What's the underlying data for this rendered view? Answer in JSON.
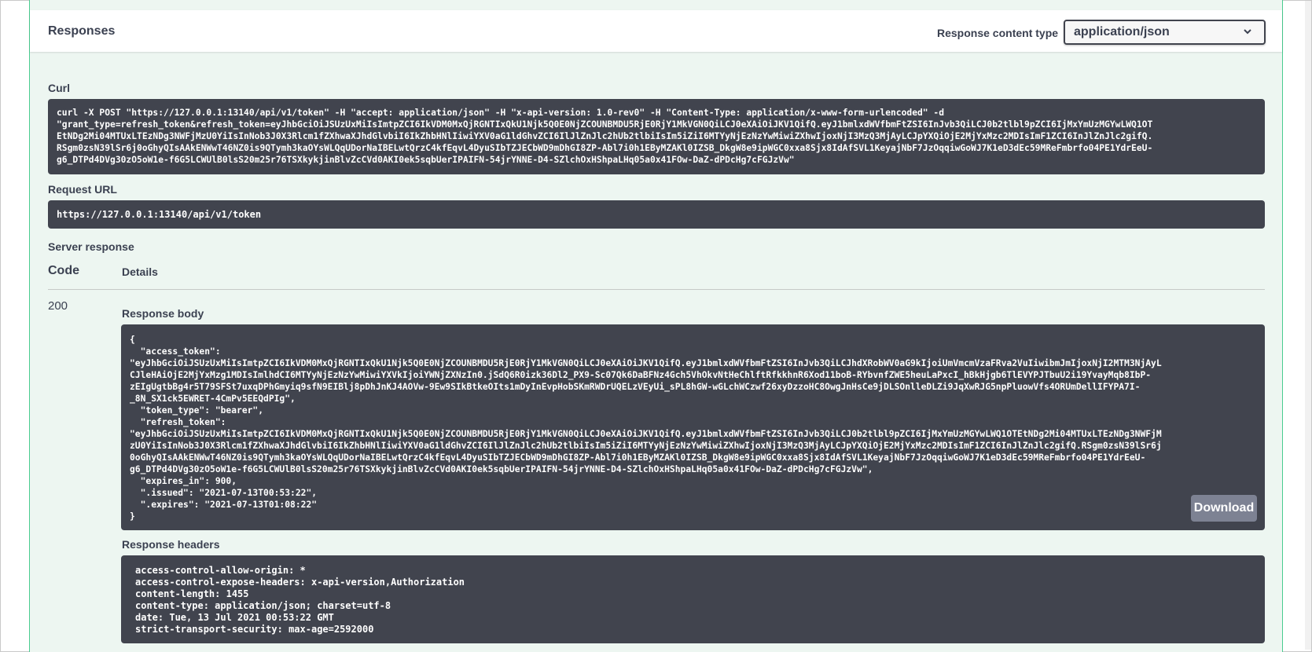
{
  "responses": {
    "title": "Responses",
    "content_type_label": "Response content type",
    "content_type_value": "application/json",
    "content_type_icon": "chevron-down-icon"
  },
  "curl": {
    "label": "Curl",
    "lines": [
      "curl -X POST \"https://127.0.0.1:13140/api/v1/token\" -H \"accept: application/json\" -H \"x-api-version: 1.0-rev0\" -H \"Content-Type: application/x-www-form-urlencoded\" -d",
      "\"grant_type=refresh_token&refresh_token=eyJhbGciOiJSUzUxMiIsImtpZCI6IkVDM0MxQjRGNTIxQkU1Njk5Q0E0NjZCOUNBMDU5RjE0RjY1MkVGN0QiLCJ0eXAiOiJKV1QifQ.eyJ1bmlxdWVfbmFtZSI6InJvb3QiLCJ0b2tlbl9pZCI6IjMxYmUzMGYwLWQ1OT",
      "EtNDg2Mi04MTUxLTEzNDg3NWFjMzU0YiIsInNob3J0X3Rlcm1fZXhwaXJhdGlvbiI6IkZhbHNlIiwiYXV0aG1ldGhvZCI6IlJlZnJlc2hUb2tlbiIsIm5iZiI6MTYyNjEzNzYwMiwiZXhwIjoxNjI3MzQ3MjAyLCJpYXQiOjE2MjYxMzc2MDIsImF1ZCI6InJlZnJlc2gifQ.",
      "RSgm0zsN39lSr6j0oGhyQIsAAkENWwT46NZ0is9QTymh3kaOYsWLQqUDorNaIBELwtQrzC4kfEqvL4DyuSIbTZJECbWD9mDhGI8ZP-Abl7i0h1EByMZAKl0IZSB_DkgW8e9ipWGC0xxa8Sjx8IdAfSVL1KeyajNbF7JzOqqiwGoWJ7K1eD3dEc59MReFmbrfo04PE1YdrEeU-",
      "g6_DTPd4DVg30zO5oW1e-f6G5LCWUlB0lsS20m25r76TSXkykjinBlvZcCVd0AKI0ek5sqbUerIPAIFN-54jrYNNE-D4-SZlchOxHShpaLHq05a0x41FOw-DaZ-dPDcHg7cFGJzVw\""
    ]
  },
  "request_url": {
    "label": "Request URL",
    "value": "https://127.0.0.1:13140/api/v1/token"
  },
  "server_response": {
    "label": "Server response",
    "code_header": "Code",
    "details_header": "Details",
    "code": "200",
    "body_label": "Response body",
    "body_lines": [
      "{",
      "  \"access_token\":",
      "\"eyJhbGciOiJSUzUxMiIsImtpZCI6IkVDM0MxQjRGNTIxQkU1Njk5Q0E0NjZCOUNBMDU5RjE0RjY1MkVGN0QiLCJ0eXAiOiJKV1QifQ.eyJ1bmlxdWVfbmFtZSI6InJvb3QiLCJhdXRobWV0aG9kIjoiUmVmcmVzaFRva2VuIiwibmJmIjoxNjI2MTM3NjAyL",
      "CJleHAiOjE2MjYxMzg1MDIsImlhdCI6MTYyNjEzNzYwMiwiYXVkIjoiYWNjZXNzIn0.jSdQ6R0izk36Dl2_PX9-Sc07Qk6DaBFNz4Gch5VhOkvNtHeChlftRfkkhnR6Xod11boB-RYbvnfZWE5heuLaPxcI_hBkHjgb6TlEVYPJTbuU2i19YvayMqb8IbP-",
      "zEIgUgtbBg4r5T79SFSt7uxqDPhGmyiq9sfN9EIBlj8pDhJnKJ4AOVw-9Ew9SIkBtkeOIts1mDyInEvpHobSKmRWDrUQELzVEyUi_sPL8hGW-wGLchWCzwf26xyDzzoHC8OwgJnHsCe9jDLSOnlleDLZi9JqXwRJG5npPluowVfs4ORUmDellIFYPA7I-",
      "_8N_SX1ck5EWRET-4CmPv5EEQdPIg\",",
      "  \"token_type\": \"bearer\",",
      "  \"refresh_token\":",
      "\"eyJhbGciOiJSUzUxMiIsImtpZCI6IkVDM0MxQjRGNTIxQkU1Njk5Q0E0NjZCOUNBMDU5RjE0RjY1MkVGN0QiLCJ0eXAiOiJKV1QifQ.eyJ1bmlxdWVfbmFtZSI6InJvb3QiLCJ0b2tlbl9pZCI6IjMxYmUzMGYwLWQ1OTEtNDg2Mi04MTUxLTEzNDg3NWFjM",
      "zU0YiIsInNob3J0X3Rlcm1fZXhwaXJhdGlvbiI6IkZhbHNlIiwiYXV0aG1ldGhvZCI6IlJlZnJlc2hUb2tlbiIsIm5iZiI6MTYyNjEzNzYwMiwiZXhwIjoxNjI3MzQ3MjAyLCJpYXQiOjE2MjYxMzc2MDIsImF1ZCI6InJlZnJlc2gifQ.RSgm0zsN39lSr6j",
      "0oGhyQIsAAkENWwT46NZ0is9QTymh3kaOYsWLQqUDorNaIBELwtQrzC4kfEqvL4DyuSIbTZJECbWD9mDhGI8ZP-Abl7i0h1EByMZAKl0IZSB_DkgW8e9ipWGC0xxa8Sjx8IdAfSVL1KeyajNbF7JzOqqiwGoWJ7K1eD3dEc59MReFmbrfo04PE1YdrEeU-",
      "g6_DTPd4DVg30zO5oW1e-f6G5LCWUlB0lsS20m25r76TSXkykjinBlvZcCVd0AKI0ek5sqbUerIPAIFN-54jrYNNE-D4-SZlchOxHShpaLHq05a0x41FOw-DaZ-dPDcHg7cFGJzVw\",",
      "  \"expires_in\": 900,",
      "  \".issued\": \"2021-07-13T00:53:22\",",
      "  \".expires\": \"2021-07-13T01:08:22\"",
      "}"
    ],
    "download_label": "Download",
    "headers_label": "Response headers",
    "header_lines": [
      "access-control-allow-origin: *",
      "access-control-expose-headers: x-api-version,Authorization",
      "content-length: 1455",
      "content-type: application/json; charset=utf-8",
      "date: Tue, 13 Jul 2021 00:53:22 GMT",
      "strict-transport-security: max-age=2592000"
    ]
  },
  "colors": {
    "section_bg": "#edf6f1",
    "section_border": "#49cc90",
    "code_bg": "#41444e",
    "text": "#3b4151",
    "download_bg": "#7d8293"
  }
}
